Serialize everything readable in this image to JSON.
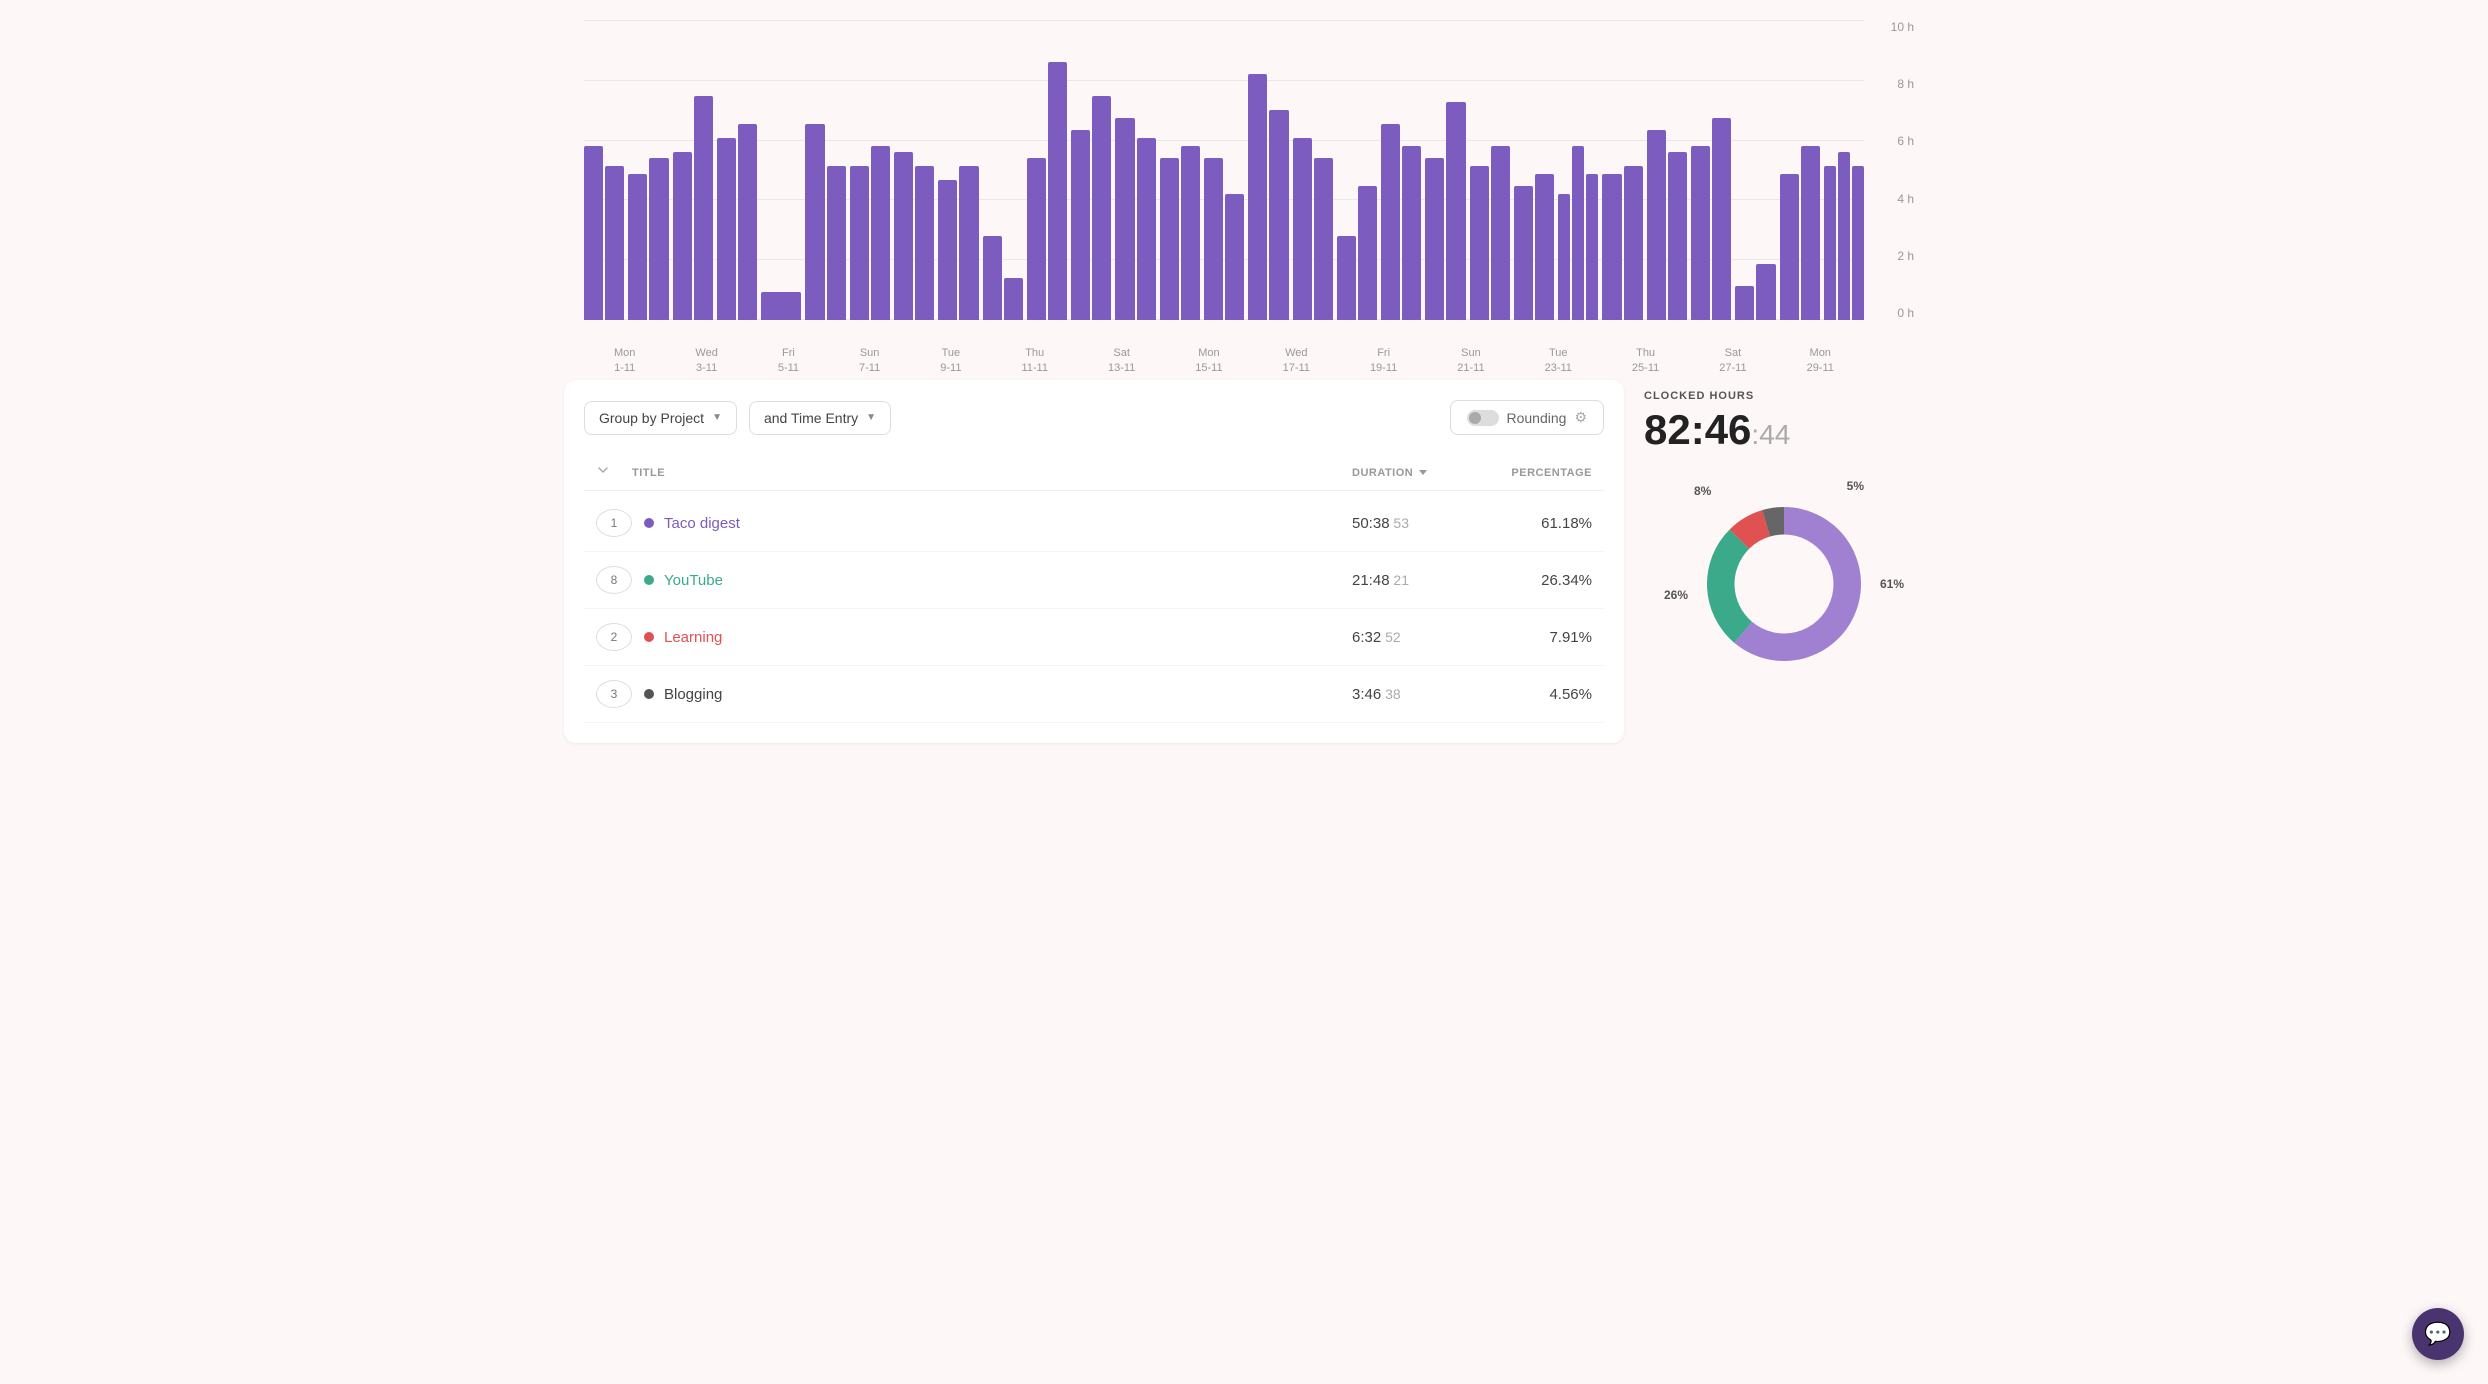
{
  "chart": {
    "y_labels": [
      "10 h",
      "8 h",
      "6 h",
      "4 h",
      "2 h",
      "0 h"
    ],
    "x_labels": [
      {
        "day": "Mon",
        "date": "1-11"
      },
      {
        "day": "Wed",
        "date": "3-11"
      },
      {
        "day": "Fri",
        "date": "5-11"
      },
      {
        "day": "Sun",
        "date": "7-11"
      },
      {
        "day": "Tue",
        "date": "9-11"
      },
      {
        "day": "Thu",
        "date": "11-11"
      },
      {
        "day": "Sat",
        "date": "13-11"
      },
      {
        "day": "Mon",
        "date": "15-11"
      },
      {
        "day": "Wed",
        "date": "17-11"
      },
      {
        "day": "Fri",
        "date": "19-11"
      },
      {
        "day": "Sun",
        "date": "21-11"
      },
      {
        "day": "Tue",
        "date": "23-11"
      },
      {
        "day": "Thu",
        "date": "25-11"
      },
      {
        "day": "Sat",
        "date": "27-11"
      },
      {
        "day": "Mon",
        "date": "29-11"
      }
    ],
    "bar_groups": [
      [
        62,
        55
      ],
      [
        52,
        58
      ],
      [
        60,
        80
      ],
      [
        65,
        70
      ],
      [
        10
      ],
      [
        70,
        55
      ],
      [
        55,
        62
      ],
      [
        60,
        55
      ],
      [
        50,
        55
      ],
      [
        30,
        15
      ],
      [
        58,
        92
      ],
      [
        68,
        80
      ],
      [
        72,
        65
      ],
      [
        58,
        62
      ],
      [
        58,
        45
      ],
      [
        88,
        75
      ],
      [
        65,
        58
      ],
      [
        30,
        48
      ],
      [
        70,
        62
      ],
      [
        58,
        78
      ],
      [
        55,
        62
      ],
      [
        48,
        52
      ],
      [
        45,
        62,
        52
      ],
      [
        52,
        55
      ],
      [
        68,
        60
      ],
      [
        62,
        72
      ],
      [
        12,
        20
      ],
      [
        52,
        62
      ],
      [
        55,
        60,
        55
      ]
    ]
  },
  "controls": {
    "group_by_label": "Group by Project",
    "time_entry_label": "and Time Entry",
    "rounding_label": "Rounding"
  },
  "table": {
    "headers": {
      "title": "TITLE",
      "duration": "DURATION",
      "percentage": "PERCENTAGE"
    },
    "rows": [
      {
        "number": "1",
        "dot_color": "#7c5cbf",
        "title": "Taco digest",
        "title_color": "#7c5cbf",
        "duration_main": "50:38",
        "duration_sec": "53",
        "percentage": "61.18%"
      },
      {
        "number": "8",
        "dot_color": "#3aaa8a",
        "title": "YouTube",
        "title_color": "#3aaa8a",
        "duration_main": "21:48",
        "duration_sec": "21",
        "percentage": "26.34%"
      },
      {
        "number": "2",
        "dot_color": "#e05252",
        "title": "Learning",
        "title_color": "#e05252",
        "duration_main": "6:32",
        "duration_sec": "52",
        "percentage": "7.91%"
      },
      {
        "number": "3",
        "dot_color": "#555",
        "title": "Blogging",
        "title_color": "#444",
        "duration_main": "3:46",
        "duration_sec": "38",
        "percentage": "4.56%"
      }
    ]
  },
  "clocked": {
    "label": "CLOCKED HOURS",
    "hours": "82:46",
    "seconds": ":44"
  },
  "donut": {
    "segments": [
      {
        "label": "61%",
        "value": 61.18,
        "color": "#a080d0"
      },
      {
        "label": "26%",
        "value": 26.34,
        "color": "#3aaa8a"
      },
      {
        "label": "8%",
        "value": 7.91,
        "color": "#e05252"
      },
      {
        "label": "5%",
        "value": 4.56,
        "color": "#666"
      }
    ]
  },
  "chat_button": {
    "icon": "💬"
  }
}
